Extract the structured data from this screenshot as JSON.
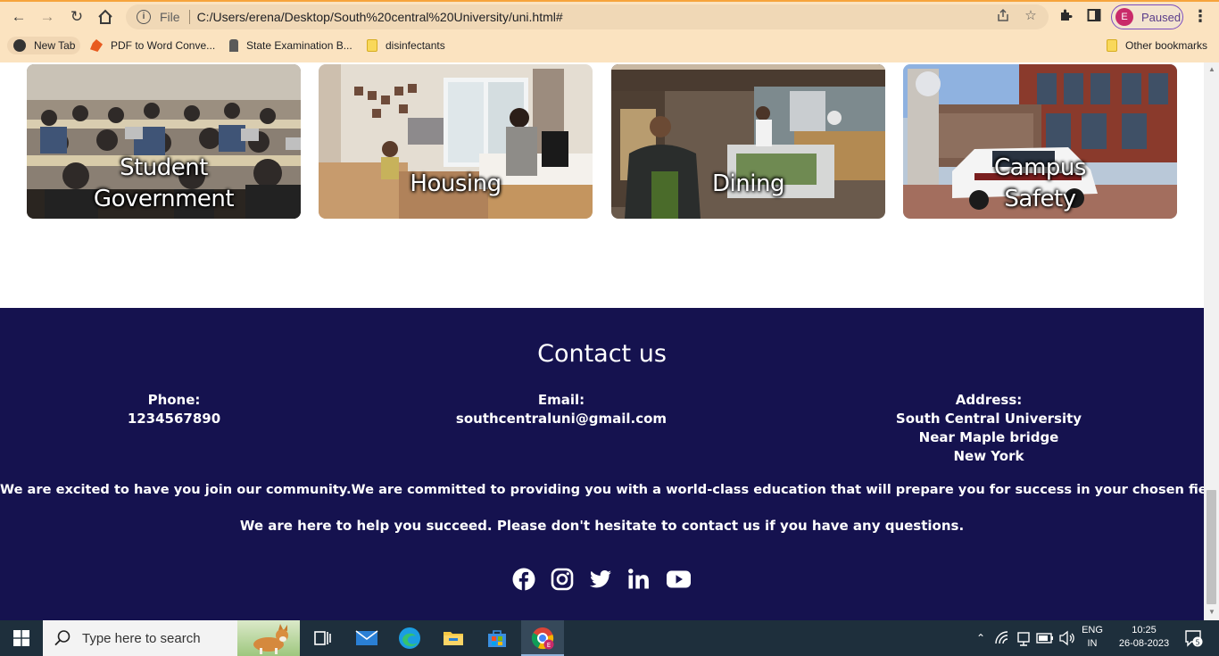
{
  "browser": {
    "url_scheme": "File",
    "url": "C:/Users/erena/Desktop/South%20central%20University/uni.html#",
    "profile_initial": "E",
    "profile_status": "Paused",
    "bookmarks": [
      {
        "label": "New Tab",
        "icon": "globe-icon"
      },
      {
        "label": "PDF to Word Conve...",
        "icon": "pdf-icon"
      },
      {
        "label": "State Examination B...",
        "icon": "emblem-icon"
      },
      {
        "label": "disinfectants",
        "icon": "folder-icon"
      }
    ],
    "other_bookmarks": "Other bookmarks"
  },
  "cards": [
    {
      "title_line1": "Student",
      "title_line2": "Government"
    },
    {
      "title_line1": "Housing",
      "title_line2": ""
    },
    {
      "title_line1": "Dining",
      "title_line2": ""
    },
    {
      "title_line1": "Campus",
      "title_line2": "Safety"
    }
  ],
  "footer": {
    "title": "Contact us",
    "phone": {
      "label": "Phone:",
      "value": "1234567890"
    },
    "email": {
      "label": "Email:",
      "value": "southcentraluni@gmail.com"
    },
    "address": {
      "label": "Address:",
      "line1": "South Central University",
      "line2": "Near Maple bridge",
      "line3": "New York"
    },
    "message1": "We are excited to have you join our community.We are committed to providing you with a world-class education that will prepare you for success in your chosen field. n",
    "message2": "We are here to help you succeed. Please don't hesitate to contact us if you have any questions.",
    "socials": [
      "facebook-icon",
      "instagram-icon",
      "twitter-icon",
      "linkedin-icon",
      "youtube-icon"
    ]
  },
  "taskbar": {
    "search_placeholder": "Type here to search",
    "lang_top": "ENG",
    "lang_bottom": "IN",
    "time": "10:25",
    "date": "26-08-2023",
    "notification_count": "5"
  }
}
